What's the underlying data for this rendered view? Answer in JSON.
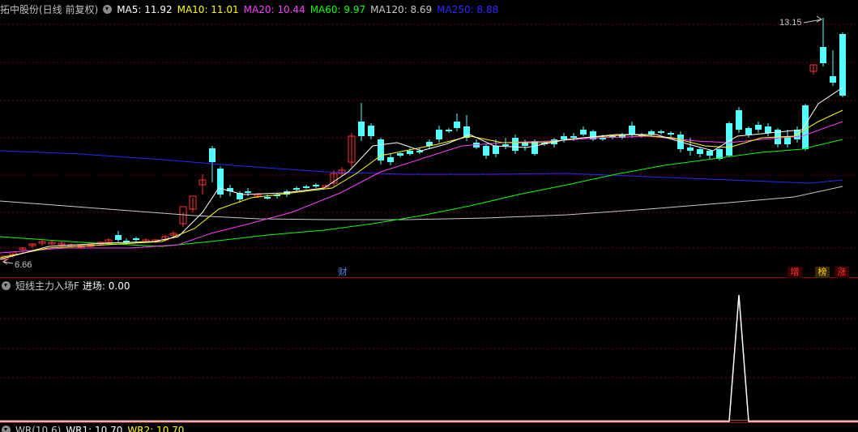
{
  "main": {
    "stock_title": "拓中股份(日线 前复权)",
    "ma": [
      {
        "label": "MA5: 11.92",
        "color": "#ffffff"
      },
      {
        "label": "MA10: 11.01",
        "color": "#ffff00"
      },
      {
        "label": "MA20: 10.44",
        "color": "#ff3cff"
      },
      {
        "label": "MA60: 9.97",
        "color": "#00ff00"
      },
      {
        "label": "MA120: 8.69",
        "color": "#c8c8c8"
      },
      {
        "label": "MA250: 8.88",
        "color": "#2828ff"
      }
    ],
    "high_label": "13.15",
    "low_label": "6.66",
    "markers": {
      "cai": "财",
      "zeng": "增",
      "bang": "榜",
      "zhang": "涨"
    }
  },
  "indicator1": {
    "title": "短线主力入场F",
    "value_label": "进场: 0.00"
  },
  "indicator2": {
    "items": [
      {
        "label": "WR(10,6)",
        "color": "#c8c8c8"
      },
      {
        "label": "WR1: 10.70",
        "color": "#ffffff"
      },
      {
        "label": "WR2: 10.70",
        "color": "#ffff00"
      }
    ]
  },
  "colors": {
    "up": "#ff3232",
    "down": "#54ffff",
    "grid": "#7a0000",
    "frame": "#a00000"
  }
}
